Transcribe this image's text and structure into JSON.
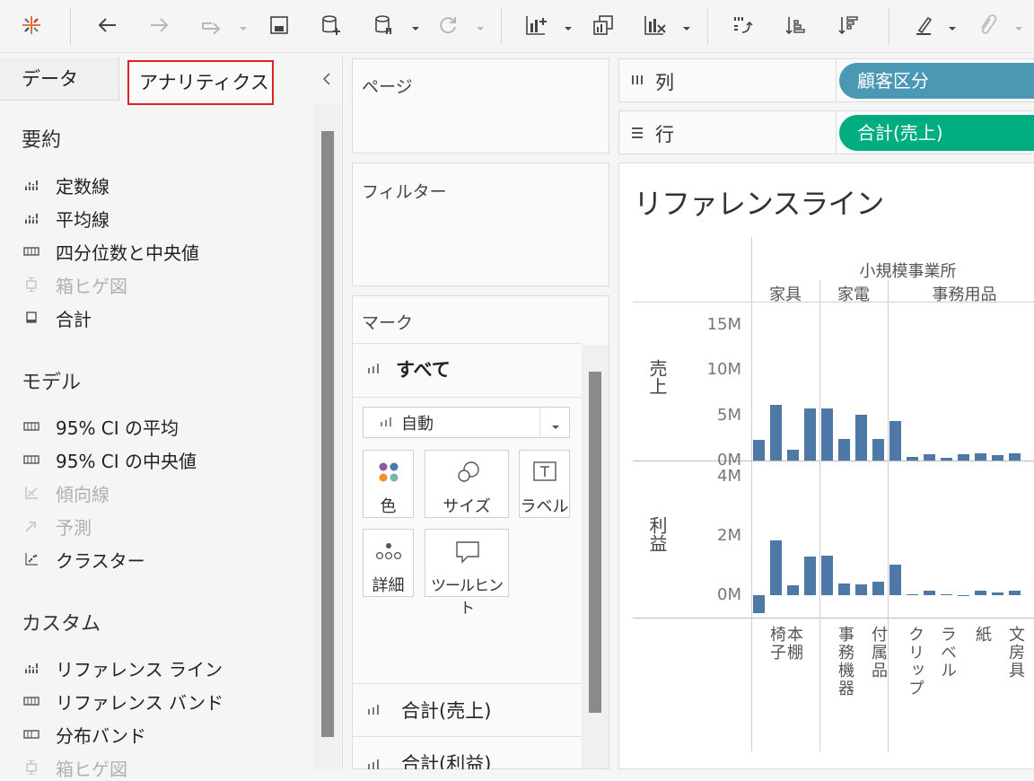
{
  "toolbar": {
    "buttons": [
      "tableau-logo-icon",
      "back-icon",
      "forward-icon",
      "redo-icon",
      "save-icon",
      "new-datasource-icon",
      "pause-update-icon",
      "refresh-icon",
      "new-worksheet-icon",
      "duplicate-sheet-icon",
      "clear-sheet-icon",
      "swap-axes-icon",
      "sort-ascending-icon",
      "sort-descending-icon",
      "highlight-icon",
      "group-members-icon"
    ]
  },
  "left_pane": {
    "tabs": [
      "データ",
      "アナリティクス"
    ],
    "active_tab": "アナリティクス",
    "highlight_color": "#e02020",
    "sections": [
      {
        "title": "要約",
        "items": [
          {
            "label": "定数線",
            "icon": "constant-line-icon",
            "enabled": true
          },
          {
            "label": "平均線",
            "icon": "average-line-icon",
            "enabled": true
          },
          {
            "label": "四分位数と中央値",
            "icon": "quartile-icon",
            "enabled": true
          },
          {
            "label": "箱ヒゲ図",
            "icon": "box-plot-icon",
            "enabled": false
          },
          {
            "label": "合計",
            "icon": "totals-icon",
            "enabled": true
          }
        ]
      },
      {
        "title": "モデル",
        "items": [
          {
            "label": "95% CI の平均",
            "icon": "ci-mean-icon",
            "enabled": true
          },
          {
            "label": "95% CI の中央値",
            "icon": "ci-median-icon",
            "enabled": true
          },
          {
            "label": "傾向線",
            "icon": "trend-line-icon",
            "enabled": false
          },
          {
            "label": "予測",
            "icon": "forecast-icon",
            "enabled": false
          },
          {
            "label": "クラスター",
            "icon": "cluster-icon",
            "enabled": true
          }
        ]
      },
      {
        "title": "カスタム",
        "items": [
          {
            "label": "リファレンス ライン",
            "icon": "reference-line-icon",
            "enabled": true
          },
          {
            "label": "リファレンス バンド",
            "icon": "reference-band-icon",
            "enabled": true
          },
          {
            "label": "分布バンド",
            "icon": "distribution-band-icon",
            "enabled": true
          },
          {
            "label": "箱ヒゲ図",
            "icon": "box-plot-icon",
            "enabled": false
          }
        ]
      }
    ]
  },
  "cards": {
    "pages": "ページ",
    "filters": "フィルター",
    "marks": {
      "title": "マーク",
      "all_label": "すべて",
      "mark_type": "自動",
      "buttons": [
        "色",
        "サイズ",
        "ラベル",
        "詳細",
        "ツールヒント"
      ],
      "measures": [
        "合計(売上)",
        "合計(利益)"
      ]
    }
  },
  "shelves": {
    "columns_label": "列",
    "rows_label": "行",
    "columns_pill": "顧客区分",
    "rows_pill": "合計(売上)",
    "columns_pill_color": "#4a98b4",
    "rows_pill_color": "#00ad80"
  },
  "chart_data": {
    "type": "bar",
    "title": "リファレンスライン",
    "bar_color": "#4e79a7",
    "segment": "小規模事業所",
    "category_groups": [
      {
        "name": "家具",
        "subcategories": [
          "椅子",
          "本棚"
        ]
      },
      {
        "name": "家電",
        "subcategories": [
          "事務機器",
          "付属品"
        ]
      },
      {
        "name": "事務用品",
        "subcategories": [
          "クリップ",
          "ラベル",
          "紙",
          "文房具"
        ]
      }
    ],
    "series": [
      {
        "name": "売上",
        "ylim": [
          0,
          17
        ],
        "ticks": [
          "15M",
          "10M",
          "5M",
          "0M"
        ],
        "tick_values": [
          15,
          10,
          5,
          0
        ],
        "values": [
          2.3,
          6.2,
          1.2,
          5.8,
          5.8,
          2.4,
          5.1,
          2.4,
          4.4,
          0.4,
          0.7,
          0.3,
          0.7,
          0.8,
          0.6,
          0.8,
          2.3
        ]
      },
      {
        "name": "利益",
        "ylim": [
          -0.75,
          4.4
        ],
        "ticks": [
          "4M",
          "2M",
          "0M"
        ],
        "tick_values": [
          4,
          2,
          0
        ],
        "values": [
          -0.6,
          1.85,
          0.35,
          1.3,
          1.35,
          0.4,
          0.38,
          0.45,
          1.05,
          0.05,
          0.15,
          0.05,
          -0.02,
          0.15,
          0.1,
          0.15,
          0.1
        ]
      }
    ]
  }
}
